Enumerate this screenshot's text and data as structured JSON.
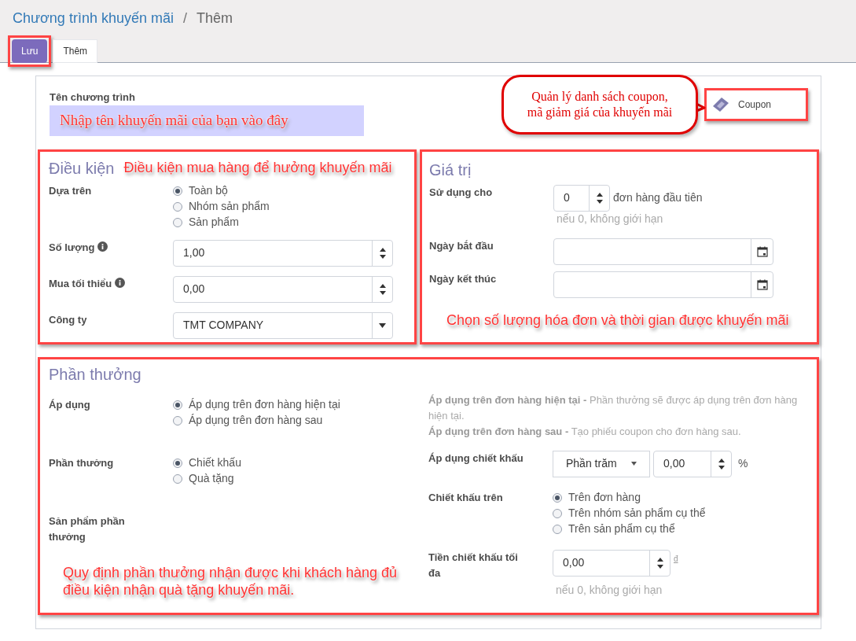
{
  "breadcrumb": {
    "parent": "Chương trình khuyến mãi",
    "separator": "/",
    "current": "Thêm"
  },
  "actions": [
    {
      "label": "Lưu",
      "kind": "primary",
      "highlighted": true
    },
    {
      "label": "Thêm",
      "kind": "secondary",
      "highlighted": false
    }
  ],
  "program_name": {
    "label": "Tên chương trình",
    "note": "Nhập tên khuyến mãi của bạn vào đây"
  },
  "coupon_button": {
    "label": "Coupon",
    "highlighted": true,
    "callout": "Quản lý danh sách coupon,\nmã giảm giá của khuyến mãi"
  },
  "conditions": {
    "title": "Điều kiện",
    "note": "Điều kiện mua hàng để hưởng khuyến mãi",
    "fields": [
      {
        "kind": "radio",
        "label": "Dựa trên",
        "info": false,
        "options": [
          {
            "label": "Toàn bộ",
            "selected": true
          },
          {
            "label": "Nhóm sản phẩm",
            "selected": false
          },
          {
            "label": "Sản phẩm",
            "selected": false
          }
        ]
      },
      {
        "kind": "number",
        "label": "Số lượng",
        "info": true,
        "value": "1,00"
      },
      {
        "kind": "number",
        "label": "Mua tối thiểu",
        "info": true,
        "value": "0,00"
      },
      {
        "kind": "select",
        "label": "Công ty",
        "info": false,
        "value": "TMT COMPANY"
      }
    ]
  },
  "validity": {
    "title": "Giá trị",
    "note": "Chọn số lượng hóa đơn và thời gian được khuyến mãi",
    "fields": [
      {
        "kind": "count",
        "label": "Sử dụng cho",
        "value": "0",
        "suffix": "đơn hàng đầu tiên",
        "hint": "nếu 0, không giới hạn"
      },
      {
        "kind": "date",
        "label": "Ngày bắt đầu"
      },
      {
        "kind": "date",
        "label": "Ngày kết thúc"
      }
    ]
  },
  "rewards": {
    "title": "Phần thưởng",
    "note": "Quy định phần thưởng nhận được khi khách hàng đủ điều kiện nhận quà tặng khuyến mãi.",
    "left_fields": [
      {
        "kind": "radio",
        "label": "Áp dụng",
        "options": [
          {
            "label": "Áp dụng trên đơn hàng hiện tại",
            "selected": true
          },
          {
            "label": "Áp dụng trên đơn hàng sau",
            "selected": false
          }
        ]
      },
      {
        "kind": "radio",
        "label": "Phần thưởng",
        "options": [
          {
            "label": "Chiết khấu",
            "selected": true
          },
          {
            "label": "Quà tặng",
            "selected": false
          }
        ]
      },
      {
        "kind": "empty",
        "label": "Sản phẩm phần thưởng"
      }
    ],
    "help": [
      {
        "term": "Áp dụng trên đơn hàng hiện tại -",
        "text": "Phần thưởng sẽ được áp dụng trên đơn hàng hiện tại."
      },
      {
        "term": "Áp dụng trên đơn hàng sau -",
        "text": "Tạo phiếu coupon cho đơn hàng sau."
      }
    ],
    "right_fields": [
      {
        "kind": "discount",
        "label": "Áp dụng chiết khấu",
        "select": "Phần trăm",
        "value": "0,00",
        "unit": "%"
      },
      {
        "kind": "radio",
        "label": "Chiết khấu trên",
        "options": [
          {
            "label": "Trên đơn hàng",
            "selected": true
          },
          {
            "label": "Trên nhóm sản phẩm cụ thể",
            "selected": false
          },
          {
            "label": "Trên sản phẩm cụ thể",
            "selected": false
          }
        ]
      },
      {
        "kind": "money",
        "label": "Tiền chiết khấu tối đa",
        "value": "0,00",
        "currency": "đ",
        "hint": "nếu 0, không giới hạn"
      }
    ]
  }
}
